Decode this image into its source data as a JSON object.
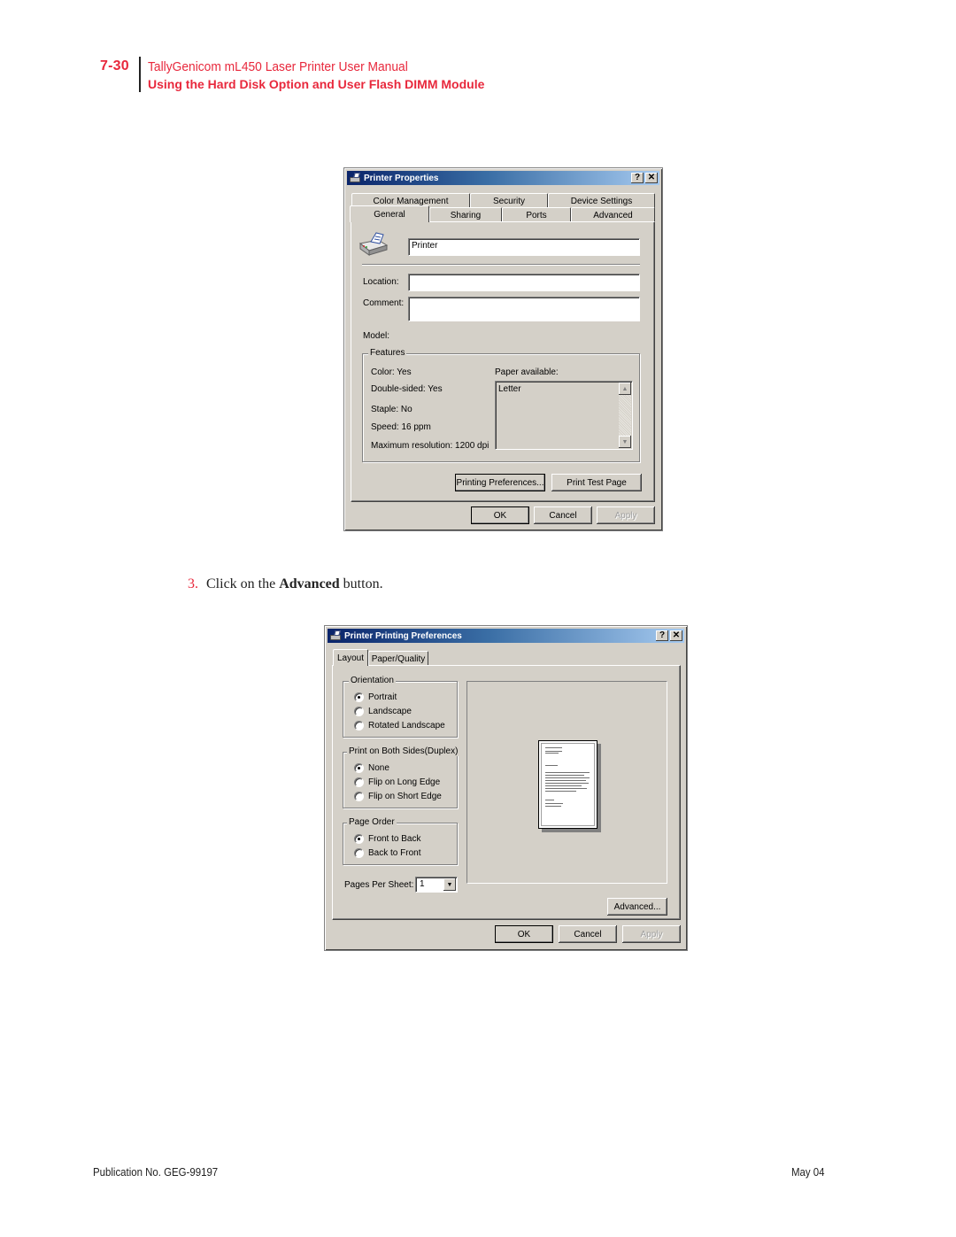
{
  "header": {
    "page_number": "7-30",
    "manual_title": "TallyGenicom mL450 Laser Printer User Manual",
    "section_title": "Using the Hard Disk Option and User Flash DIMM Module"
  },
  "dialog_properties": {
    "title": "Printer Properties",
    "title_buttons": {
      "help": "?",
      "close": "✕"
    },
    "tabs_row_back": [
      "Color Management",
      "Security",
      "Device Settings"
    ],
    "tabs_row_front": [
      "General",
      "Sharing",
      "Ports",
      "Advanced"
    ],
    "active_tab": "General",
    "printer_name": "Printer",
    "location_label": "Location:",
    "location_value": "",
    "comment_label": "Comment:",
    "comment_value": "",
    "model_label": "Model:",
    "features": {
      "title": "Features",
      "items": [
        "Color: Yes",
        "Double-sided: Yes",
        "Staple: No",
        "Speed: 16 ppm",
        "Maximum resolution: 1200 dpi"
      ],
      "paper_label": "Paper available:",
      "paper_list": [
        "Letter"
      ]
    },
    "buttons": {
      "printing_preferences": "Printing Preferences...",
      "print_test_page": "Print Test Page",
      "ok": "OK",
      "cancel": "Cancel",
      "apply": "Apply"
    },
    "icons": {
      "title": "printer-icon",
      "general": "printer-icon"
    }
  },
  "step": {
    "number": "3.",
    "text_before": "Click on the ",
    "bold": "Advanced",
    "text_after": " button."
  },
  "dialog_preferences": {
    "title": "Printer Printing Preferences",
    "title_buttons": {
      "help": "?",
      "close": "✕"
    },
    "tabs": [
      "Layout",
      "Paper/Quality"
    ],
    "active_tab": "Layout",
    "orientation": {
      "title": "Orientation",
      "options": [
        "Portrait",
        "Landscape",
        "Rotated Landscape"
      ],
      "selected": "Portrait"
    },
    "duplex": {
      "title": "Print on Both Sides(Duplex)",
      "options": [
        "None",
        "Flip on Long Edge",
        "Flip on Short Edge"
      ],
      "selected": "None"
    },
    "page_order": {
      "title": "Page Order",
      "options": [
        "Front to Back",
        "Back to Front"
      ],
      "selected": "Front to Back"
    },
    "pages_per_sheet_label": "Pages Per Sheet:",
    "pages_per_sheet_value": "1",
    "buttons": {
      "advanced": "Advanced...",
      "ok": "OK",
      "cancel": "Cancel",
      "apply": "Apply"
    }
  },
  "footer": {
    "publication": "Publication No. GEG-99197",
    "date": "May 04"
  }
}
